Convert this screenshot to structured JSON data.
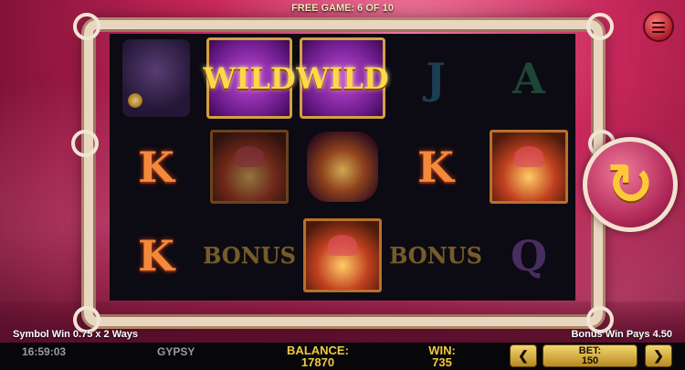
{
  "header": {
    "free_game": "FREE GAME: 6 OF 10"
  },
  "menu_icon": "hamburger-icon",
  "reels": [
    [
      {
        "kind": "gypsy",
        "name": "gypsy-woman-symbol"
      },
      {
        "kind": "letter",
        "text": "K",
        "letter": "K",
        "dim": false
      },
      {
        "kind": "letter",
        "text": "K",
        "letter": "K",
        "dim": false
      }
    ],
    [
      {
        "kind": "wild",
        "text": "WILD"
      },
      {
        "kind": "hands",
        "name": "crystal-ball-hands-symbol",
        "dim": true
      },
      {
        "kind": "bonus",
        "text": "BONUS"
      }
    ],
    [
      {
        "kind": "wild",
        "text": "WILD"
      },
      {
        "kind": "lamp",
        "name": "magic-lamp-symbol"
      },
      {
        "kind": "hands",
        "name": "crystal-ball-hands-symbol",
        "dim": false
      }
    ],
    [
      {
        "kind": "letter",
        "text": "J",
        "letter": "J",
        "dim": true
      },
      {
        "kind": "letter",
        "text": "K",
        "letter": "K",
        "dim": false
      },
      {
        "kind": "bonus",
        "text": "BONUS"
      }
    ],
    [
      {
        "kind": "letter",
        "text": "A",
        "letter": "A",
        "dim": true
      },
      {
        "kind": "hands",
        "name": "crystal-ball-hands-symbol",
        "dim": false
      },
      {
        "kind": "letter",
        "text": "Q",
        "letter": "Q",
        "dim": true
      }
    ]
  ],
  "spin_button": {
    "icon": "spin-arrow-icon",
    "glyph": "↻"
  },
  "messages": {
    "left": "Symbol Win 0.75 x 2 Ways",
    "right": "Bonus Win Pays 4.50"
  },
  "status_bar": {
    "time": "16:59:03",
    "game_name": "GYPSY",
    "balance_label": "BALANCE:",
    "balance_value": "17870",
    "win_label": "WIN:",
    "win_value": "735",
    "bet_label": "BET:",
    "bet_value": "150",
    "prev_glyph": "❮",
    "next_glyph": "❯"
  },
  "colors": {
    "accent_gold": "#f2c840",
    "background_pink": "#c8285c"
  }
}
